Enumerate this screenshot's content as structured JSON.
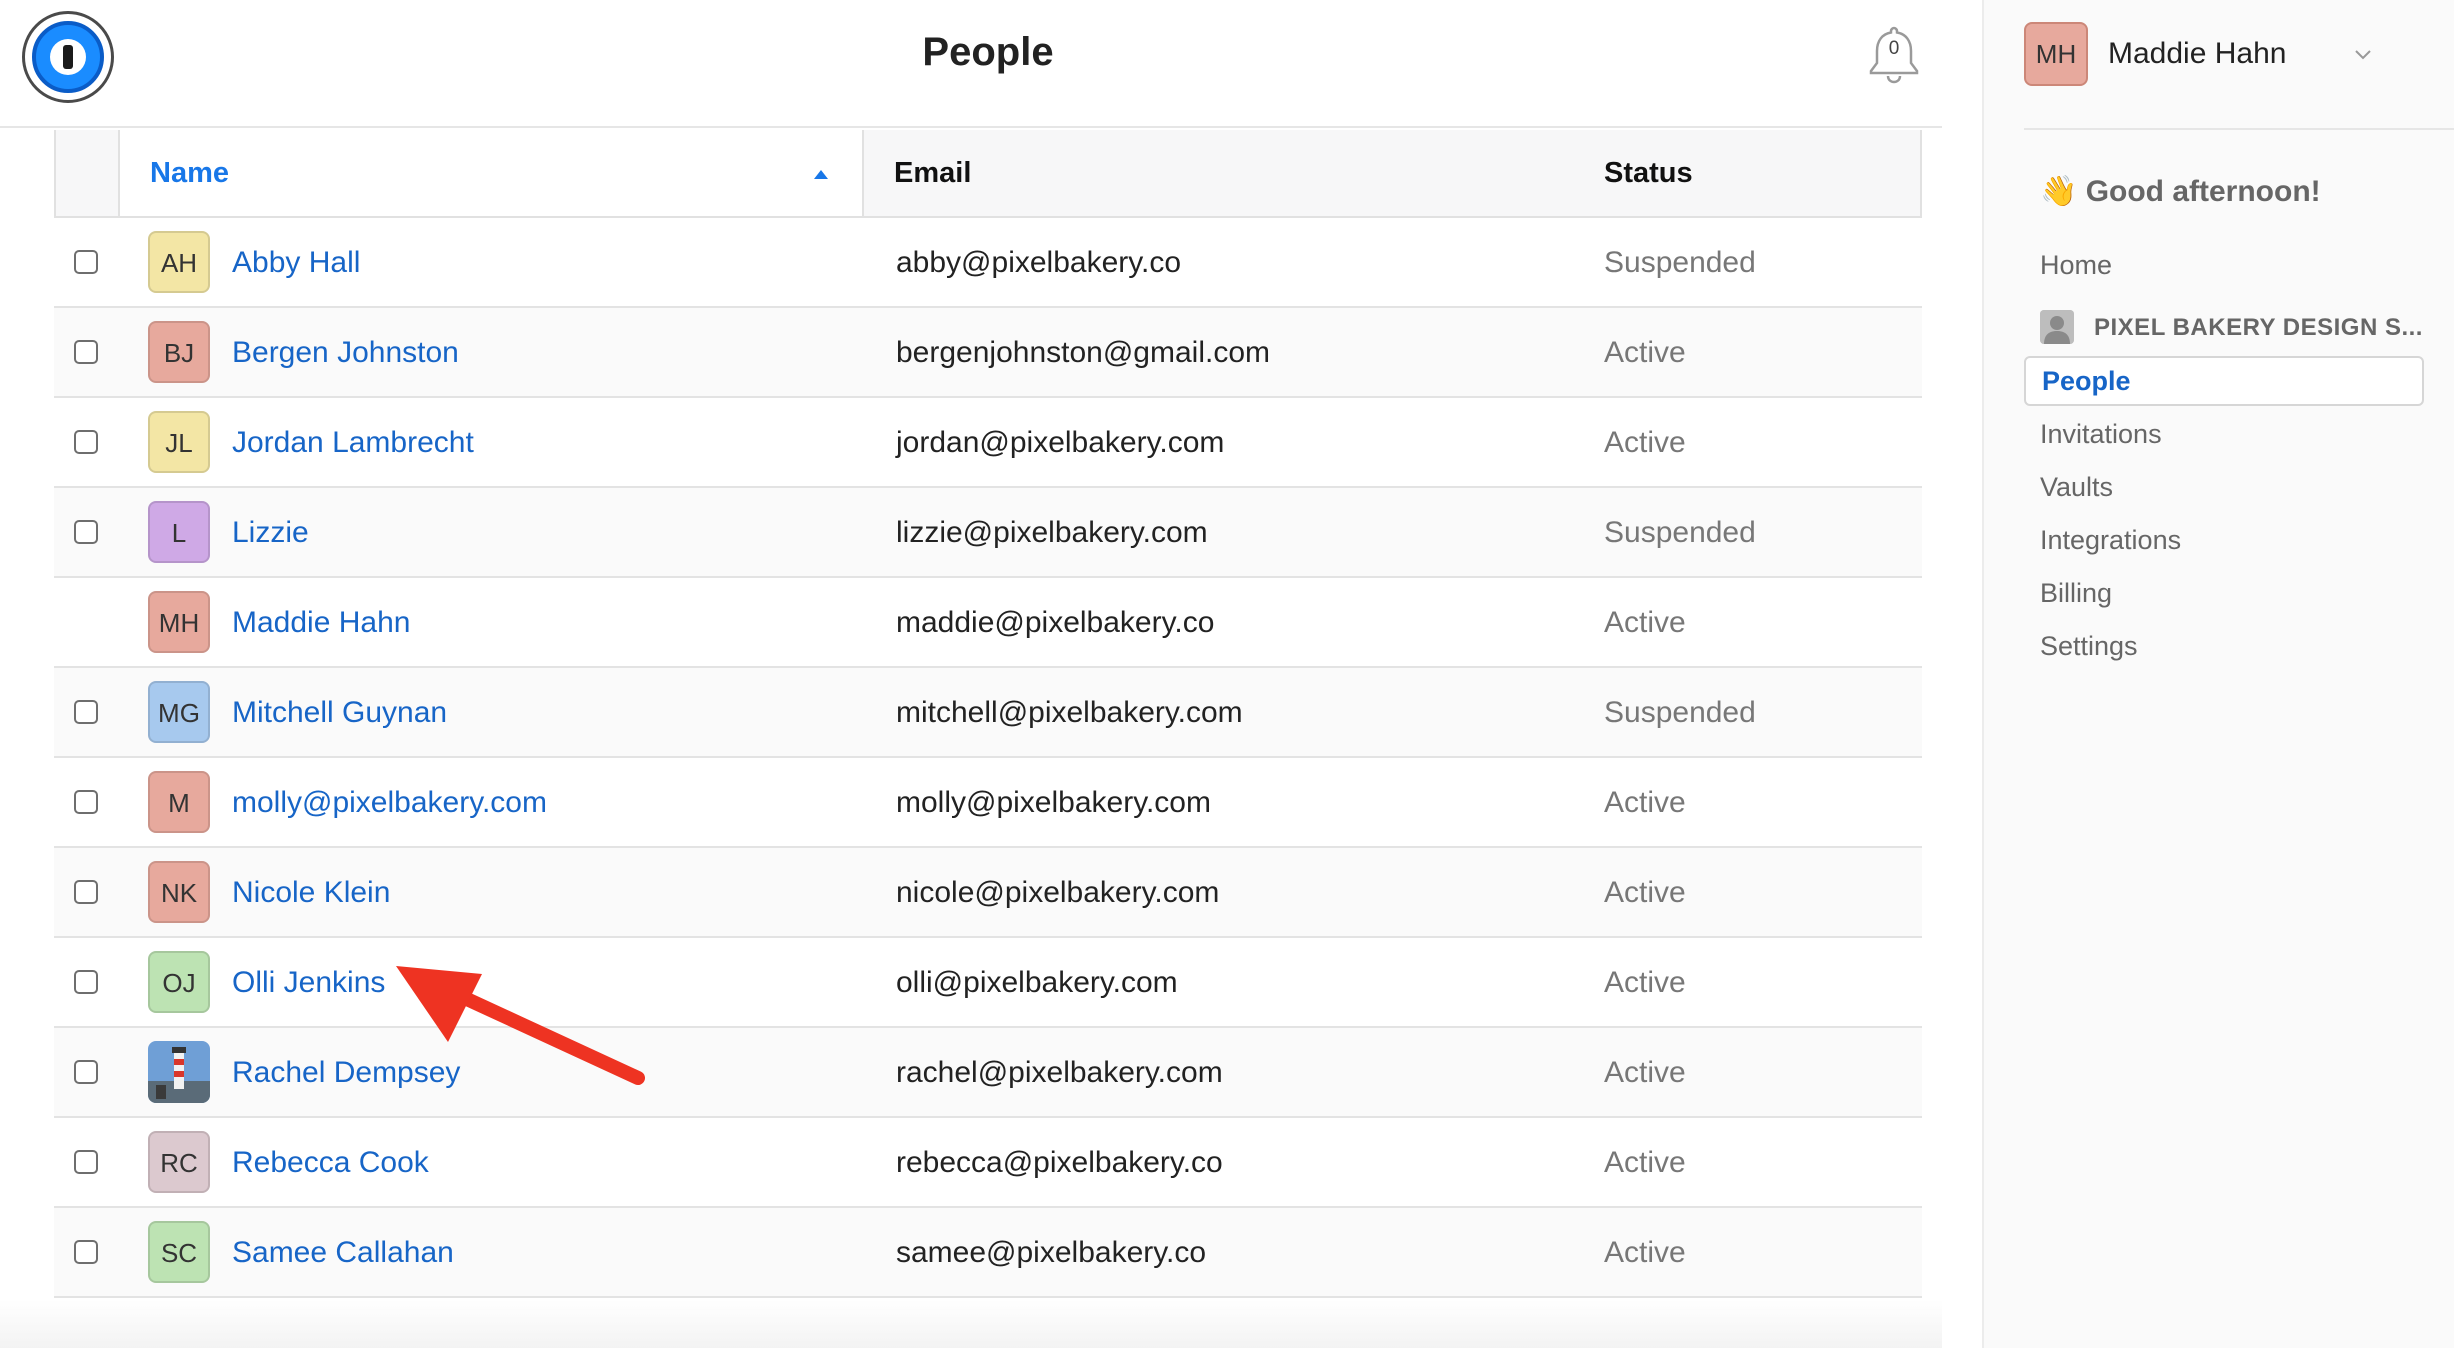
{
  "header": {
    "title": "People",
    "notification_count": "0"
  },
  "table": {
    "columns": {
      "name": "Name",
      "email": "Email",
      "status": "Status"
    },
    "rows": [
      {
        "initials": "AH",
        "name": "Abby Hall",
        "email": "abby@pixelbakery.co",
        "status": "Suspended",
        "color": "#f3e6a5",
        "checkbox": true
      },
      {
        "initials": "BJ",
        "name": "Bergen Johnston",
        "email": "bergenjohnston@gmail.com",
        "status": "Active",
        "color": "#e7a99d",
        "checkbox": true
      },
      {
        "initials": "JL",
        "name": "Jordan Lambrecht",
        "email": "jordan@pixelbakery.com",
        "status": "Active",
        "color": "#f3e6a5",
        "checkbox": true
      },
      {
        "initials": "L",
        "name": "Lizzie",
        "email": "lizzie@pixelbakery.com",
        "status": "Suspended",
        "color": "#cfa9e6",
        "checkbox": true
      },
      {
        "initials": "MH",
        "name": "Maddie Hahn",
        "email": "maddie@pixelbakery.co",
        "status": "Active",
        "color": "#e7a99d",
        "checkbox": false
      },
      {
        "initials": "MG",
        "name": "Mitchell Guynan",
        "email": "mitchell@pixelbakery.com",
        "status": "Suspended",
        "color": "#a7c9ee",
        "checkbox": true
      },
      {
        "initials": "M",
        "name": "molly@pixelbakery.com",
        "email": "molly@pixelbakery.com",
        "status": "Active",
        "color": "#e7a99d",
        "checkbox": true
      },
      {
        "initials": "NK",
        "name": "Nicole Klein",
        "email": "nicole@pixelbakery.com",
        "status": "Active",
        "color": "#e7a99d",
        "checkbox": true
      },
      {
        "initials": "OJ",
        "name": "Olli Jenkins",
        "email": "olli@pixelbakery.com",
        "status": "Active",
        "color": "#bde3b3",
        "checkbox": true
      },
      {
        "initials": "",
        "name": "Rachel Dempsey",
        "email": "rachel@pixelbakery.com",
        "status": "Active",
        "color": "#7aa5d6",
        "checkbox": true,
        "photo": true
      },
      {
        "initials": "RC",
        "name": "Rebecca Cook",
        "email": "rebecca@pixelbakery.co",
        "status": "Active",
        "color": "#dcc9cf",
        "checkbox": true
      },
      {
        "initials": "SC",
        "name": "Samee Callahan",
        "email": "samee@pixelbakery.co",
        "status": "Active",
        "color": "#bde3b3",
        "checkbox": true
      }
    ]
  },
  "sidebar": {
    "user_initials": "MH",
    "user_name": "Maddie Hahn",
    "greeting": "👋 Good afternoon!",
    "home": "Home",
    "org_name": "PIXEL BAKERY DESIGN S...",
    "nav": [
      {
        "label": "People",
        "active": true
      },
      {
        "label": "Invitations",
        "active": false
      },
      {
        "label": "Vaults",
        "active": false
      },
      {
        "label": "Integrations",
        "active": false
      },
      {
        "label": "Billing",
        "active": false
      },
      {
        "label": "Settings",
        "active": false
      }
    ]
  },
  "colors": {
    "link": "#1765c7",
    "header_link": "#1877e8",
    "annotation_arrow": "#ee3322"
  }
}
